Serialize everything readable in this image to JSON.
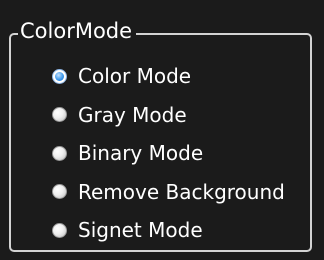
{
  "group": {
    "title": "ColorMode",
    "options": [
      {
        "label": "Color Mode",
        "checked": true
      },
      {
        "label": "Gray Mode",
        "checked": false
      },
      {
        "label": "Binary Mode",
        "checked": false
      },
      {
        "label": "Remove Background",
        "checked": false
      },
      {
        "label": "Signet Mode",
        "checked": false
      }
    ],
    "selected": "Color Mode"
  },
  "colors": {
    "background": "#1b1b1b",
    "border": "#d3d3d3",
    "text": "#ffffff",
    "radio_selected": "#3f9bef"
  },
  "icons": {
    "radio_checked": "radio-checked-icon",
    "radio_unchecked": "radio-unchecked-icon"
  }
}
